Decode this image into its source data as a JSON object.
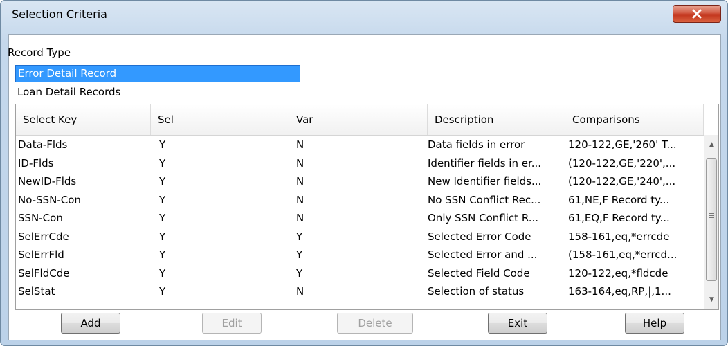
{
  "window": {
    "title": "Selection Criteria"
  },
  "record_type": {
    "label": "Record Type",
    "items": [
      {
        "label": "Error Detail Record",
        "selected": true
      },
      {
        "label": "Loan Detail Records",
        "selected": false
      }
    ]
  },
  "grid": {
    "columns": [
      "Select Key",
      "Sel",
      "Var",
      "Description",
      "Comparisons"
    ],
    "rows": [
      {
        "key": "Data-Flds",
        "sel": "Y",
        "var": "N",
        "desc": "Data fields in error",
        "comp": "120-122,GE,'260'  T..."
      },
      {
        "key": "ID-Flds",
        "sel": "Y",
        "var": "N",
        "desc": "Identifier fields in er...",
        "comp": "(120-122,GE,'220',..."
      },
      {
        "key": "NewID-Flds",
        "sel": "Y",
        "var": "N",
        "desc": "New Identifier fields...",
        "comp": "(120-122,GE,'240',..."
      },
      {
        "key": "No-SSN-Con",
        "sel": "Y",
        "var": "N",
        "desc": "No SSN Conflict Rec...",
        "comp": "61,NE,F  Record ty..."
      },
      {
        "key": "SSN-Con",
        "sel": "Y",
        "var": "N",
        "desc": "Only SSN Conflict R...",
        "comp": "61,EQ,F  Record ty..."
      },
      {
        "key": "SelErrCde",
        "sel": "Y",
        "var": "Y",
        "desc": "Selected Error Code",
        "comp": "158-161,eq,*errcde"
      },
      {
        "key": "SelErrFld",
        "sel": "Y",
        "var": "Y",
        "desc": "Selected Error and ...",
        "comp": "(158-161,eq,*errcd..."
      },
      {
        "key": "SelFldCde",
        "sel": "Y",
        "var": "Y",
        "desc": "Selected Field Code",
        "comp": "120-122,eq,*fldcde"
      },
      {
        "key": "SelStat",
        "sel": "Y",
        "var": "N",
        "desc": "Selection of status",
        "comp": "163-164,eq,RP,|,1..."
      }
    ]
  },
  "buttons": {
    "add": "Add",
    "edit": "Edit",
    "delete": "Delete",
    "exit": "Exit",
    "help": "Help"
  },
  "icons": {
    "close": "close-icon",
    "scroll_up": "scroll-up-arrow-icon",
    "scroll_down": "scroll-down-arrow-icon"
  }
}
